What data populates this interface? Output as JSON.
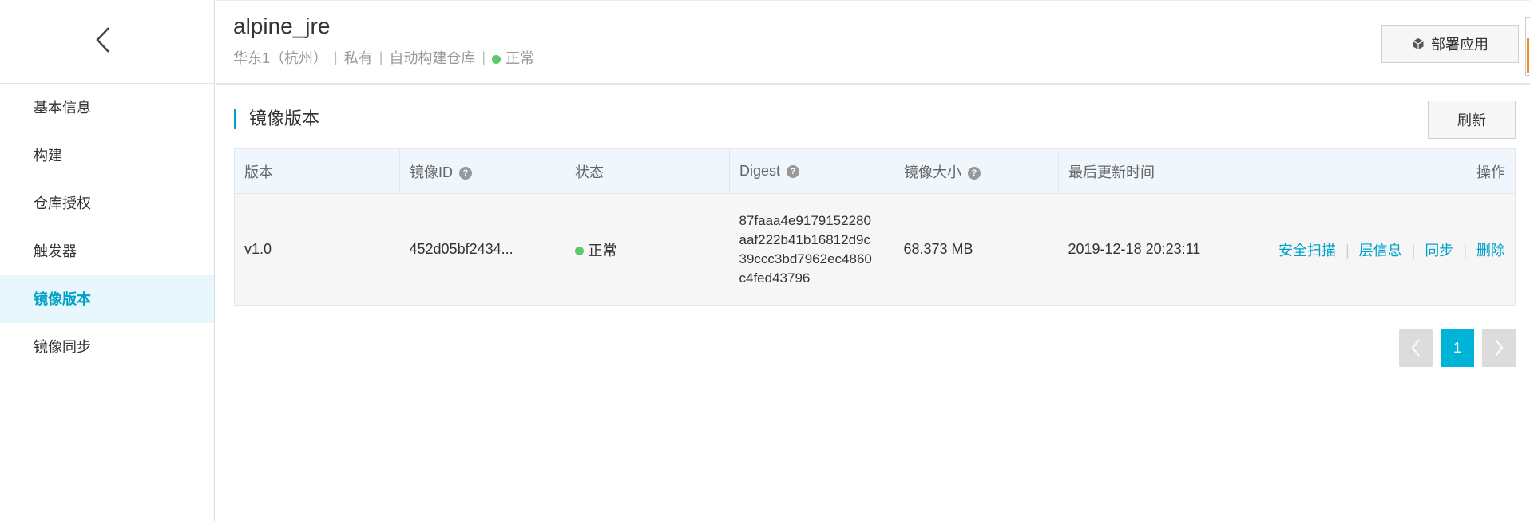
{
  "sidebar": {
    "items": [
      {
        "label": "基本信息",
        "active": false
      },
      {
        "label": "构建",
        "active": false
      },
      {
        "label": "仓库授权",
        "active": false
      },
      {
        "label": "触发器",
        "active": false
      },
      {
        "label": "镜像版本",
        "active": true
      },
      {
        "label": "镜像同步",
        "active": false
      }
    ]
  },
  "header": {
    "title": "alpine_jre",
    "region": "华东1（杭州）",
    "sep": "|",
    "visibility": "私有",
    "repo_type": "自动构建仓库",
    "status": "正常",
    "deploy_label": "部署应用"
  },
  "section": {
    "title": "镜像版本",
    "refresh_label": "刷新"
  },
  "table": {
    "columns": [
      "版本",
      "镜像ID",
      "状态",
      "Digest",
      "镜像大小",
      "最后更新时间",
      "操作"
    ],
    "help_glyph": "?",
    "rows": [
      {
        "version": "v1.0",
        "image_id": "452d05bf2434...",
        "status": "正常",
        "digest_lines": [
          "87faaa4e9179152280",
          "aaf222b41b16812d9c",
          "39ccc3bd7962ec4860",
          "c4fed43796"
        ],
        "size": "68.373 MB",
        "updated": "2019-12-18 20:23:11",
        "ops": [
          "安全扫描",
          "层信息",
          "同步",
          "删除"
        ]
      }
    ],
    "op_sep": "|"
  },
  "pagination": {
    "current": "1"
  },
  "colors": {
    "accent": "#00a2ca",
    "status_ok": "#5cc96a",
    "brand_orange": "#f5731f"
  }
}
